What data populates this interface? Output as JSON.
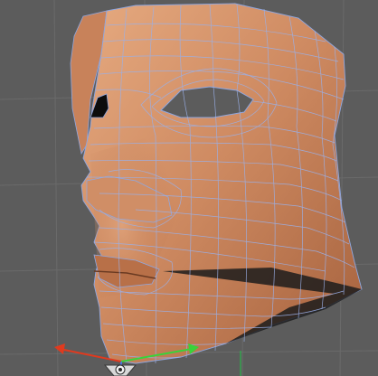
{
  "app": {
    "view": "perspective-viewport",
    "view_label": ""
  },
  "colors": {
    "background": "#5c5c5c",
    "grid": "#6f6f6f",
    "skin_light": "#e0a27a",
    "skin_mid": "#c8845c",
    "skin_dark": "#7a4a30",
    "wire": "#8fa7e0",
    "axis_x": "#e03a1e",
    "axis_y": "#3ad23a",
    "axis_z": "#4a7aff"
  },
  "icons": {
    "world_origin": "axis-gizmo-icon",
    "camera_target": "camera-target-icon",
    "object": "polygon-mesh-head"
  },
  "mesh": {
    "object_type": "polygon-mesh",
    "display": "smooth-shaded-with-wireframe",
    "selected": false
  }
}
